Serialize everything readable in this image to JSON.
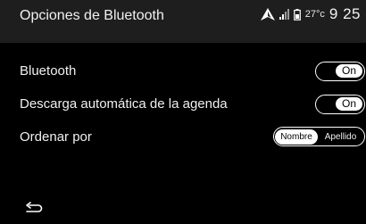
{
  "header": {
    "title": "Opciones de Bluetooth",
    "temperature": "27°c",
    "clock": "9 25",
    "icons": [
      "navigation-arrow-icon",
      "signal-icon",
      "battery-icon"
    ]
  },
  "settings": [
    {
      "label": "Bluetooth",
      "value": "On"
    },
    {
      "label": "Descarga automática de la agenda",
      "value": "On"
    }
  ],
  "sort": {
    "label": "Ordenar por",
    "options": [
      "Nombre",
      "Apellido"
    ],
    "selected": "Nombre"
  },
  "footer": {
    "back_icon": "back-arrow-icon"
  },
  "colors": {
    "background": "#000000",
    "header_background": "#1e1e1e",
    "text": "#ffffff"
  }
}
